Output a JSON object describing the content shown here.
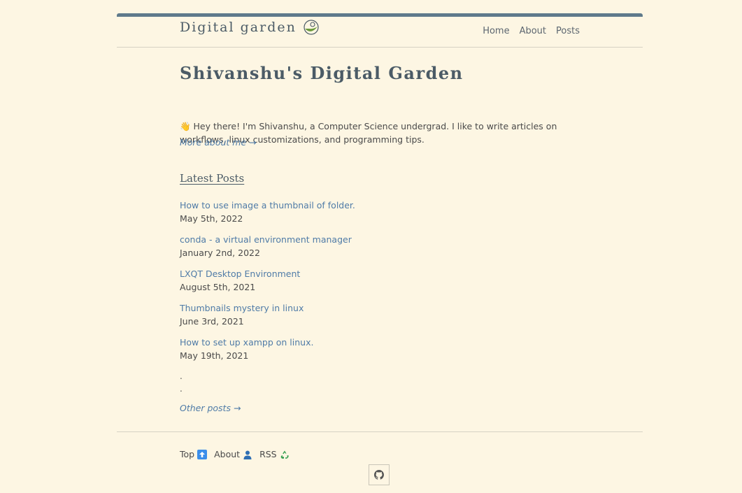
{
  "header": {
    "brand": "Digital garden",
    "brand_icon": "leaf-logo-icon",
    "nav": [
      "Home",
      "About",
      "Posts"
    ]
  },
  "main": {
    "title": "Shivanshu's Digital Garden",
    "intro_icon": "waving-hand-icon",
    "intro": "👋 Hey there! I'm Shivanshu, a Computer Science undergrad. I like to write articles on workflows, linux customizations, and programming tips.",
    "more_link": "More about me →",
    "latest_heading": "Latest Posts",
    "posts": [
      {
        "title": "How to use image a thumbnail of folder.",
        "date": "May 5th, 2022"
      },
      {
        "title": "conda - a virtual environment manager",
        "date": "January 2nd, 2022"
      },
      {
        "title": "LXQT Desktop Environment",
        "date": "August 5th, 2021"
      },
      {
        "title": "Thumbnails mystery in linux",
        "date": "June 3rd, 2021"
      },
      {
        "title": "How to set up xampp on linux.",
        "date": "May 19th, 2021"
      }
    ],
    "dots": [
      ".",
      "."
    ],
    "other_link": "Other posts →"
  },
  "footer": {
    "links": [
      {
        "label": "Top",
        "icon": "arrow-up-icon"
      },
      {
        "label": "About",
        "icon": "person-icon"
      },
      {
        "label": "RSS",
        "icon": "recycle-icon"
      }
    ],
    "github_icon": "github-icon"
  },
  "colors": {
    "background": "#fdf6e3",
    "accent_bar": "#5f7a8b",
    "link": "#4f7ba7",
    "heading": "#4b5b66"
  }
}
